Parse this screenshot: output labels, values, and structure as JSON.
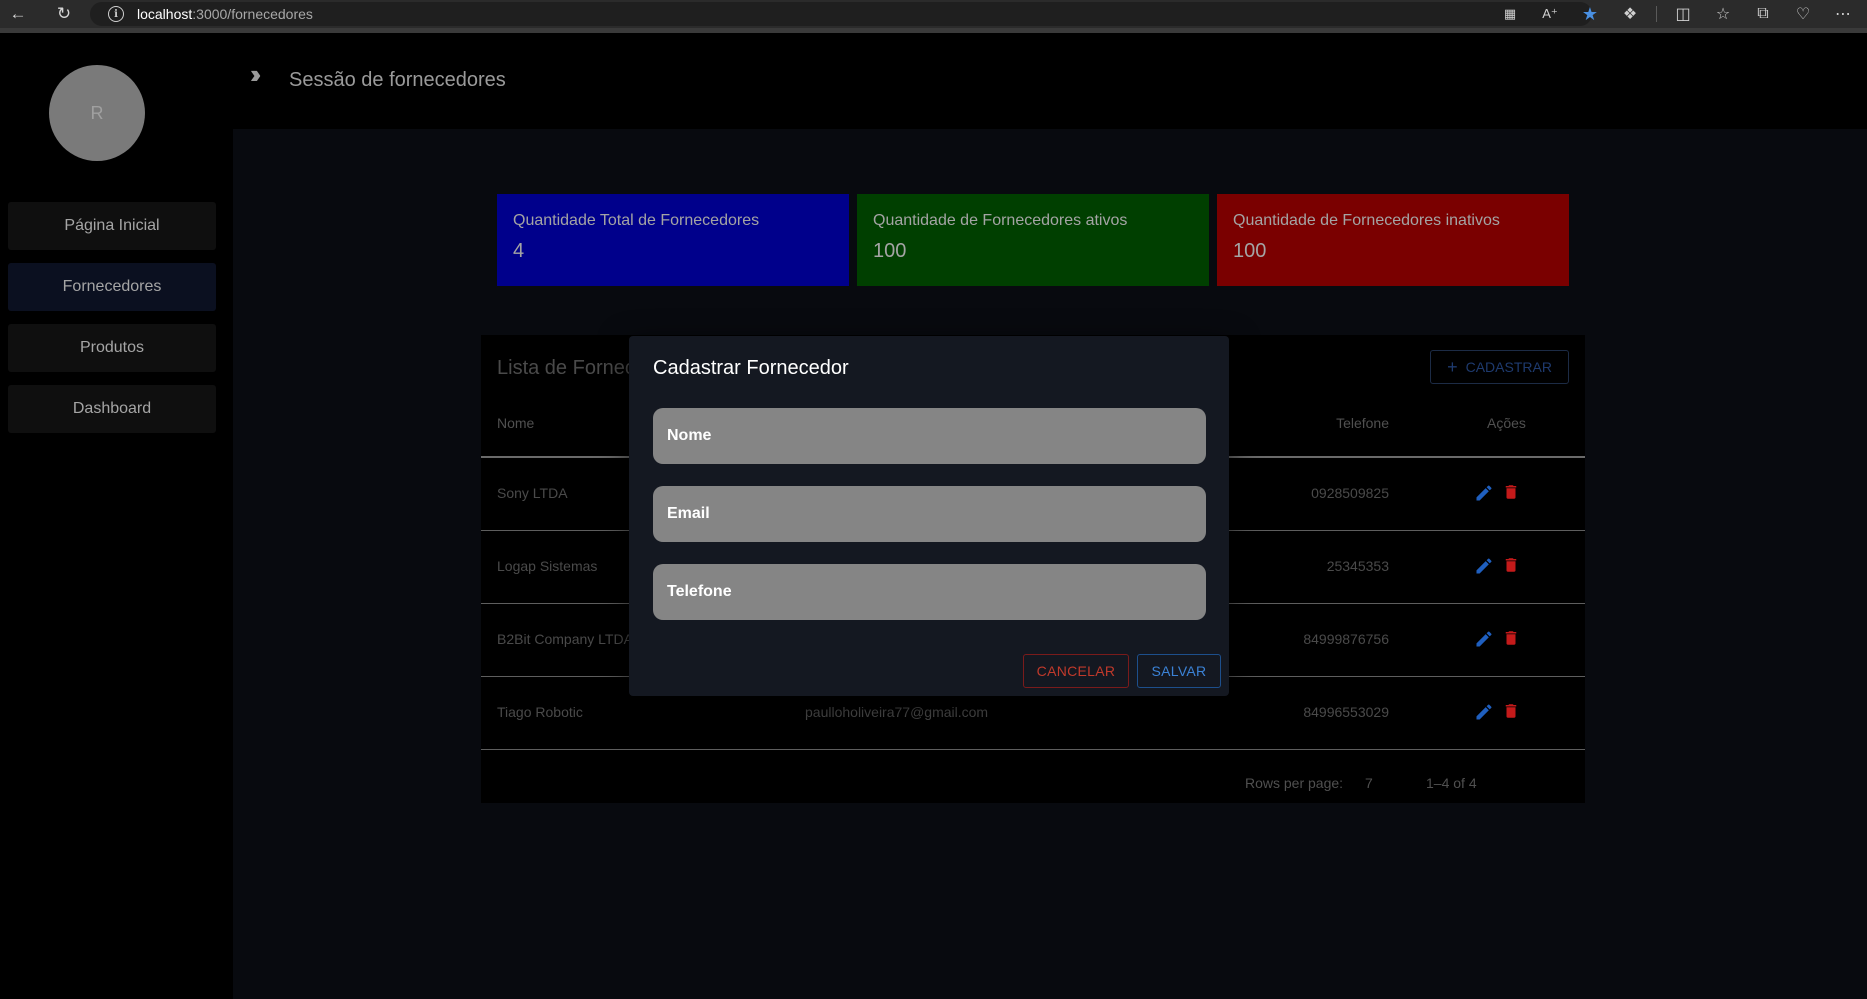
{
  "browser": {
    "url_host": "localhost",
    "url_path": ":3000/fornecedores"
  },
  "sidebar": {
    "avatar_initial": "R",
    "items": [
      {
        "label": "Página Inicial",
        "active": false
      },
      {
        "label": "Fornecedores",
        "active": true
      },
      {
        "label": "Produtos",
        "active": false
      },
      {
        "label": "Dashboard",
        "active": false
      }
    ]
  },
  "header": {
    "title": "Sessão de fornecedores"
  },
  "stats": [
    {
      "label": "Quantidade Total de Fornecedores",
      "value": "4",
      "color": "#00008b"
    },
    {
      "label": "Quantidade de Fornecedores ativos",
      "value": "100",
      "color": "#003f00"
    },
    {
      "label": "Quantidade de Fornecedores inativos",
      "value": "100",
      "color": "#7a0000"
    }
  ],
  "table": {
    "title": "Lista de Fornec",
    "add_button": "CADASTRAR",
    "columns": {
      "nome": "Nome",
      "telefone": "Telefone",
      "acoes": "Ações"
    },
    "rows": [
      {
        "nome": "Sony LTDA",
        "email": "",
        "telefone": "0928509825"
      },
      {
        "nome": "Logap Sistemas",
        "email": "",
        "telefone": "25345353"
      },
      {
        "nome": "B2Bit Company LTDA",
        "email": "",
        "telefone": "84999876756"
      },
      {
        "nome": "Tiago Robotic",
        "email": "paulloholiveira77@gmail.com",
        "telefone": "84996553029"
      }
    ],
    "pagination": {
      "rows_per_page_label": "Rows per page:",
      "rows_per_page_value": "7",
      "range": "1–4 of 4"
    }
  },
  "dialog": {
    "title": "Cadastrar Fornecedor",
    "fields": {
      "nome_placeholder": "Nome",
      "email_placeholder": "Email",
      "telefone_placeholder": "Telefone"
    },
    "cancel_label": "CANCELAR",
    "save_label": "SALVAR"
  }
}
